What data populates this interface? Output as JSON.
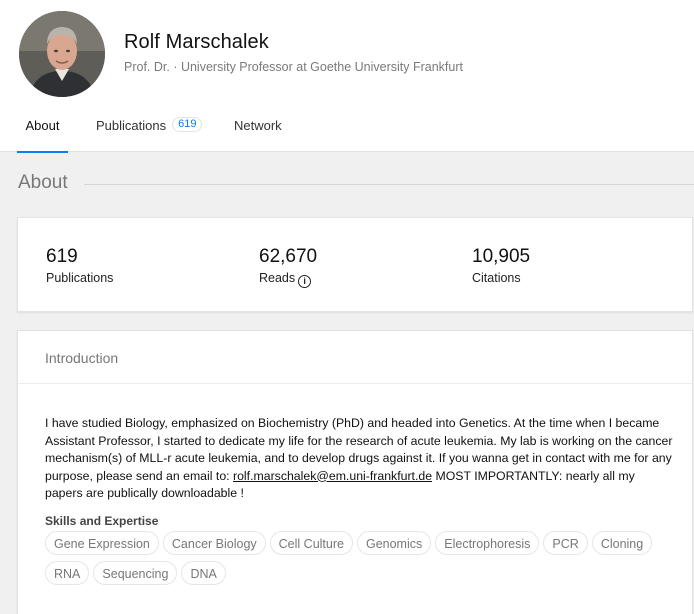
{
  "profile": {
    "name": "Rolf Marschalek",
    "subtitle": "Prof. Dr. · University Professor at Goethe University Frankfurt"
  },
  "tabs": [
    {
      "label": "About",
      "active": true
    },
    {
      "label": "Publications",
      "badge": "619"
    },
    {
      "label": "Network"
    }
  ],
  "section": {
    "title": "About"
  },
  "stats": [
    {
      "value": "619",
      "label": "Publications"
    },
    {
      "value": "62,670",
      "label": "Reads"
    },
    {
      "value": "10,905",
      "label": "Citations"
    }
  ],
  "info_icon_glyph": "i",
  "intro": {
    "title": "Introduction",
    "text_before": "I have studied Biology, emphasized on Biochemistry (PhD) and headed into Genetics. At the time when I became Assistant Professor, I started to dedicate my life for the research of acute leukemia. My lab is working on the cancer mechanism(s) of MLL-r acute leukemia, and to develop drugs against it. If you wanna get in contact with me for any purpose, please send an email to: ",
    "email": "rolf.marschalek@em.uni-frankfurt.de",
    "text_after": " MOST IMPORTANTLY: nearly all my papers are publically downloadable !"
  },
  "skills": {
    "title": "Skills and Expertise",
    "items": [
      "Gene Expression",
      "Cancer Biology",
      "Cell Culture",
      "Genomics",
      "Electrophoresis",
      "PCR",
      "Cloning",
      "RNA",
      "Sequencing",
      "DNA"
    ]
  },
  "colors": {
    "accent": "#0a7ff3",
    "background": "#f0f0f0"
  },
  "icons": {
    "reads_info": "info-icon"
  }
}
